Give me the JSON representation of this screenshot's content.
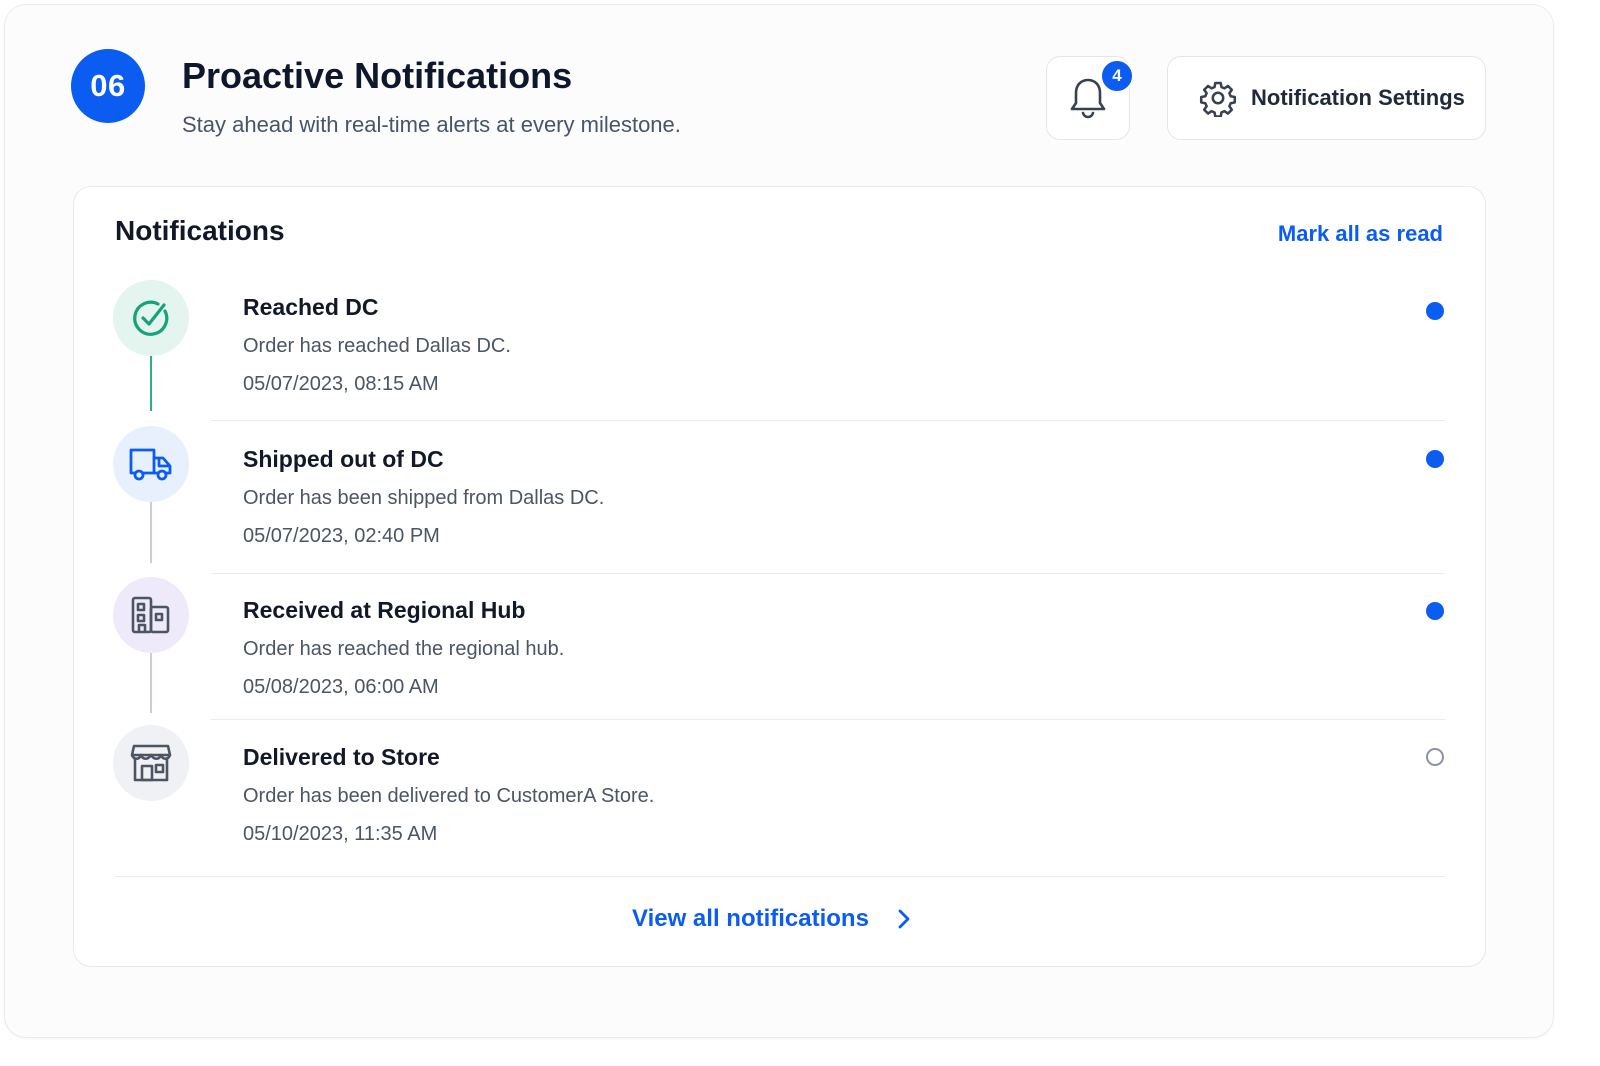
{
  "header": {
    "step_number": "06",
    "title": "Proactive Notifications",
    "subtitle": "Stay ahead with real-time alerts at every milestone.",
    "bell_badge_count": "4",
    "settings_label": "Notification Settings"
  },
  "panel": {
    "title": "Notifications",
    "mark_all_label": "Mark all as read",
    "view_all_label": "View all notifications"
  },
  "notifications": [
    {
      "title": "Reached DC",
      "description": "Order has reached Dallas DC.",
      "timestamp": "05/07/2023, 08:15 AM",
      "icon": "check-circle-icon",
      "status": "unread"
    },
    {
      "title": "Shipped out of DC",
      "description": "Order has been shipped from Dallas DC.",
      "timestamp": "05/07/2023, 02:40 PM",
      "icon": "truck-icon",
      "status": "unread"
    },
    {
      "title": "Received at Regional Hub",
      "description": "Order has reached the regional hub.",
      "timestamp": "05/08/2023, 06:00 AM",
      "icon": "building-icon",
      "status": "unread"
    },
    {
      "title": "Delivered to Store",
      "description": "Order has been delivered to CustomerA Store.",
      "timestamp": "05/10/2023, 11:35 AM",
      "icon": "store-icon",
      "status": "read"
    }
  ],
  "colors": {
    "accent": "#0b5cf0",
    "success": "#16a37a",
    "success_bg": "#e3f5ee",
    "truck_bg": "#e8f0fd",
    "hub_bg": "#efeafa",
    "store_bg": "#eff1f4"
  }
}
